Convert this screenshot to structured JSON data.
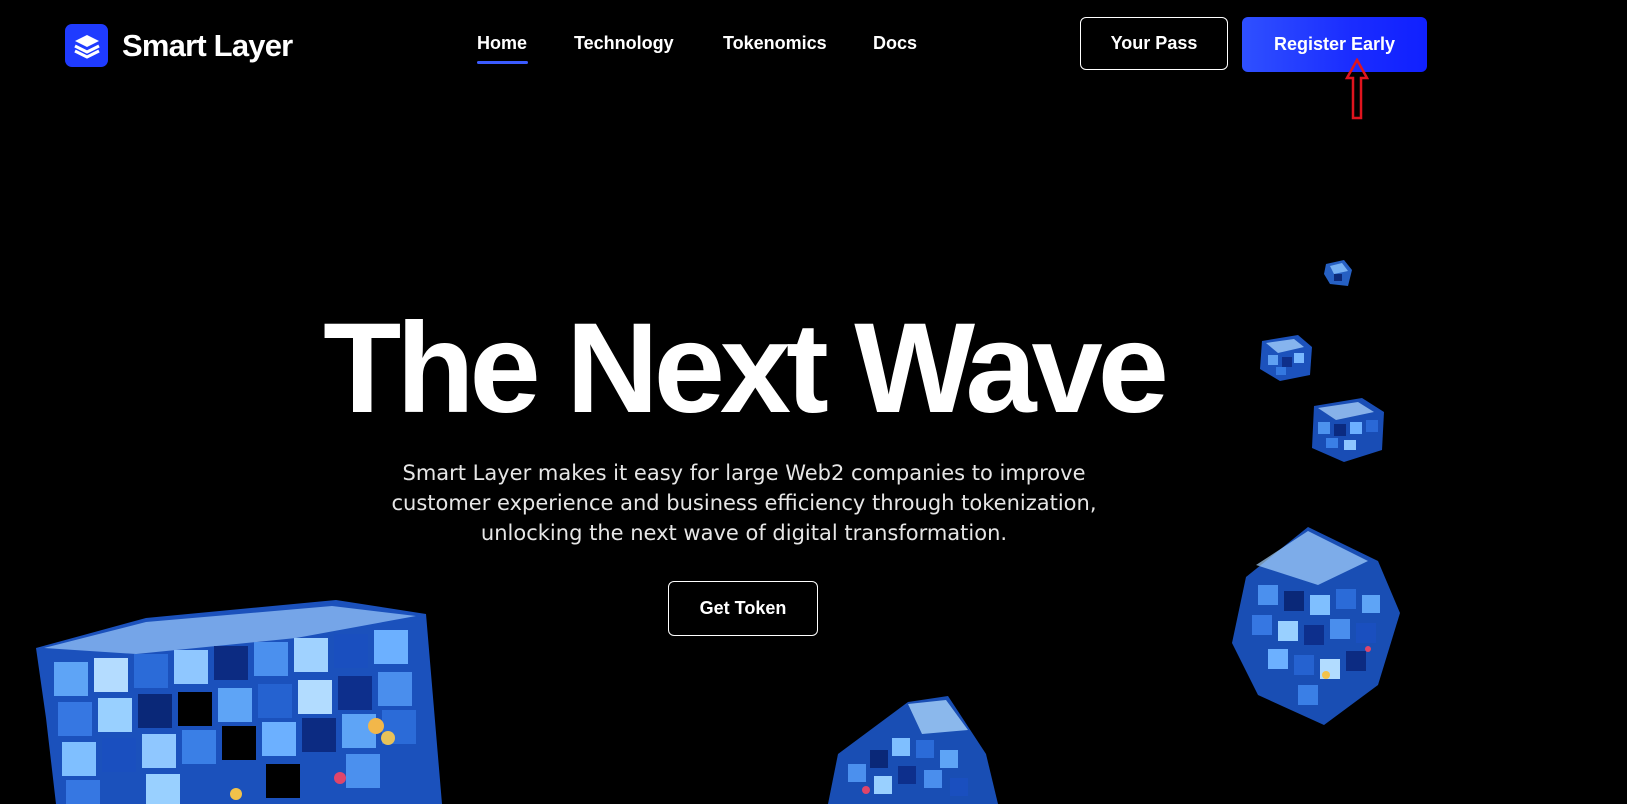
{
  "brand": {
    "name": "Smart Layer",
    "logo_icon": "layers-icon",
    "accent_color": "#1f3bff"
  },
  "nav": {
    "items": [
      {
        "label": "Home",
        "active": true
      },
      {
        "label": "Technology",
        "active": false
      },
      {
        "label": "Tokenomics",
        "active": false
      },
      {
        "label": "Docs",
        "active": false
      }
    ]
  },
  "header": {
    "your_pass_label": "Your Pass",
    "register_label": "Register Early"
  },
  "hero": {
    "title": "The Next Wave",
    "subtitle_lines": [
      "Smart Layer makes it easy for large Web2 companies to improve",
      "customer experience and business efficiency through tokenization,",
      "unlocking the next wave of digital transformation."
    ],
    "cta_label": "Get Token"
  },
  "annotation": {
    "icon": "red-up-arrow-icon",
    "color": "#e0141e"
  }
}
